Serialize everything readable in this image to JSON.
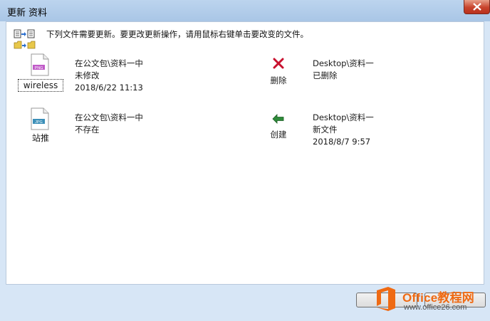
{
  "window": {
    "title": "更新 资料"
  },
  "instruction": "下列文件需要更新。要更改更新操作，请用鼠标右键单击要改变的文件。",
  "rows": [
    {
      "file_type": "PNG",
      "file_name": "wireless",
      "source_path": "在公文包\\资料一中",
      "source_status": "未修改",
      "source_time": "2018/6/22 11:13",
      "action_label": "删除",
      "action_icon": "delete-x-icon",
      "target_path": "Desktop\\资料一",
      "target_status": "已删除",
      "target_time": ""
    },
    {
      "file_type": "JPG",
      "file_name": "站推",
      "source_path": "在公文包\\资料一中",
      "source_status": "不存在",
      "source_time": "",
      "action_label": "创建",
      "action_icon": "arrow-left-icon",
      "target_path": "Desktop\\资料一",
      "target_status": "新文件",
      "target_time": "2018/8/7 9:57"
    }
  ],
  "watermark": {
    "brand": "Office教程网",
    "url": "www.office26.com"
  },
  "colors": {
    "delete": "#c8102e",
    "create": "#2e8b3a",
    "brand": "#ef6a13"
  }
}
